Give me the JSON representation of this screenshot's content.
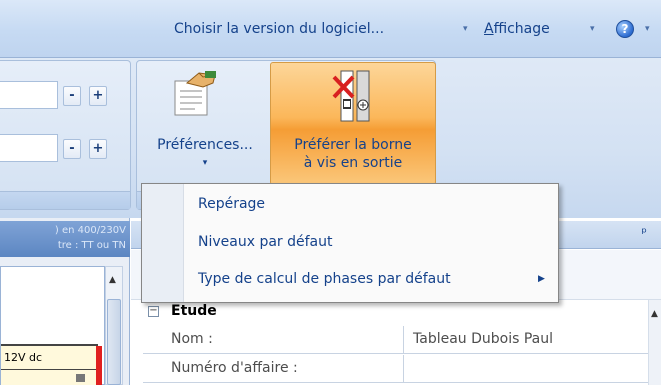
{
  "topbar": {
    "version_menu": "Choisir la version du logiciel...",
    "view_menu_prefix": "A",
    "view_menu_rest": "ffichage",
    "help_icon": "help-circle-icon",
    "dropdown_arrow": "▾",
    "help_glyph": "?"
  },
  "ribbon": {
    "spin_minus": "-",
    "spin_plus": "+",
    "preferences": {
      "label": "Préférences...",
      "arrow": "▾",
      "icon": "preferences-hand-document-icon"
    },
    "prefer_screw_terminal": {
      "line1": "Préférer la borne",
      "line2": "à vis en sortie",
      "icon": "screw-terminal-icon"
    }
  },
  "menu": {
    "items": [
      {
        "label": "Repérage"
      },
      {
        "label": "Niveaux par défaut"
      },
      {
        "label": "Type de calcul de phases par défaut",
        "submenu_arrow": "▶"
      }
    ]
  },
  "left_panel": {
    "header_line1": ") en 400/230V",
    "header_line2": "tre : TT ou TN",
    "box_label": "12V dc",
    "scroll_up": "▲"
  },
  "right_panel": {
    "pin_icon": "pin-icon",
    "pin_glyph": "ᵖ",
    "scroll_up": "▲",
    "section": {
      "toggle": "−",
      "title": "Etude"
    },
    "rows": [
      {
        "label": "Nom :",
        "value": "Tableau Dubois Paul"
      },
      {
        "label": "Numéro d'affaire :",
        "value": ""
      }
    ]
  },
  "colors": {
    "accent": "#15428b",
    "ribbon_bg": "#d3e1f3",
    "highlight_button": "#fbb75a"
  }
}
